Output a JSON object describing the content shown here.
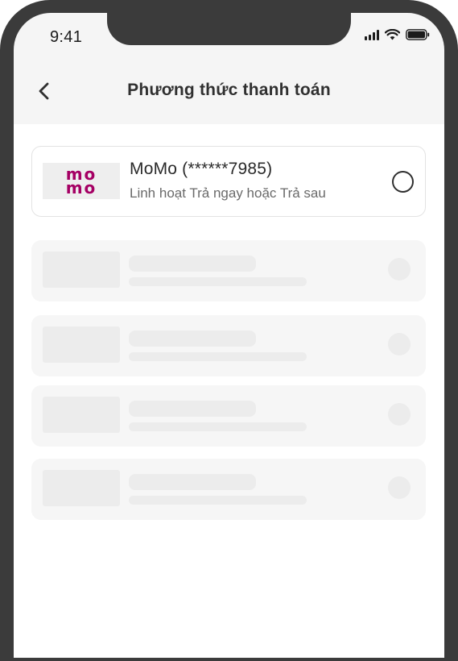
{
  "status_bar": {
    "time": "9:41",
    "icons": [
      "signal-icon",
      "wifi-icon",
      "battery-icon"
    ]
  },
  "header": {
    "back_icon": "chevron-left-icon",
    "title": "Phương thức thanh toán"
  },
  "payment_method": {
    "logo_text_top": "mo",
    "logo_text_bottom": "mo",
    "name": "MoMo (******7985)",
    "description": "Linh hoạt Trả ngay hoặc Trả sau",
    "selected": false
  },
  "loading_placeholders": 4,
  "colors": {
    "momo_brand": "#a50064",
    "device_frame": "#3b3b3b",
    "header_bg": "#f5f5f5",
    "skeleton": "#ececec"
  }
}
